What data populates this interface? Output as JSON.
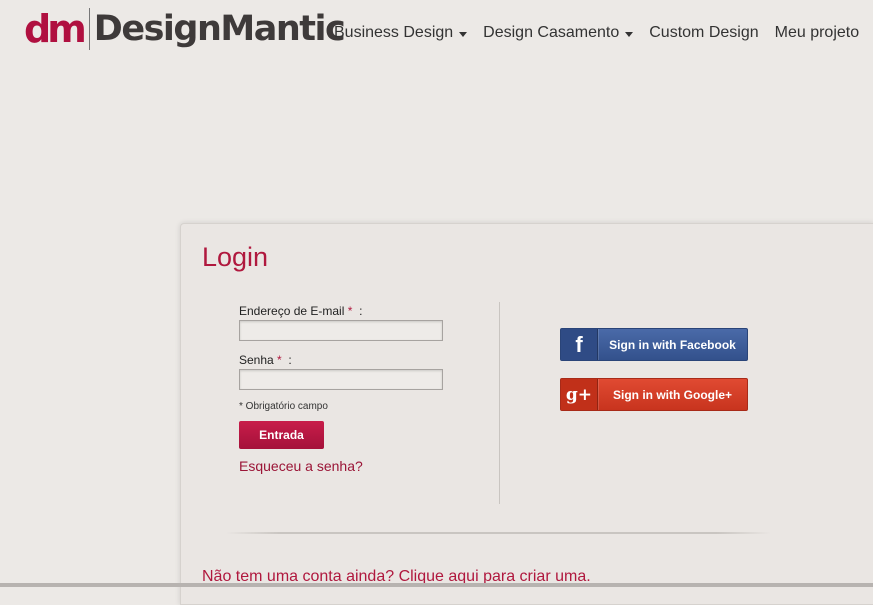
{
  "brand": {
    "mark": "dm",
    "name": "DesignMantic",
    "accent_color": "#b0183e"
  },
  "nav": {
    "items": [
      {
        "label": "Business Design",
        "has_dropdown": true
      },
      {
        "label": "Design Casamento",
        "has_dropdown": true
      },
      {
        "label": "Custom Design",
        "has_dropdown": false
      },
      {
        "label": "Meu projeto",
        "has_dropdown": false
      }
    ]
  },
  "login": {
    "title": "Login",
    "email_label": "Endereço de E-mail",
    "password_label": "Senha",
    "required_marker": "*",
    "colon": ":",
    "email_value": "",
    "password_value": "",
    "required_note": "* Obrigatório campo",
    "submit_label": "Entrada",
    "forgot_label": "Esqueceu a senha?"
  },
  "social": {
    "facebook": {
      "icon": "facebook-icon",
      "glyph": "f",
      "label": "Sign in with Facebook",
      "color": "#3b5998"
    },
    "google": {
      "icon": "google-plus-icon",
      "glyph": "g+",
      "label": "Sign in with Google+",
      "color": "#d73d27"
    }
  },
  "signup": {
    "label": "Não tem uma conta ainda? Clique aqui para criar uma."
  }
}
